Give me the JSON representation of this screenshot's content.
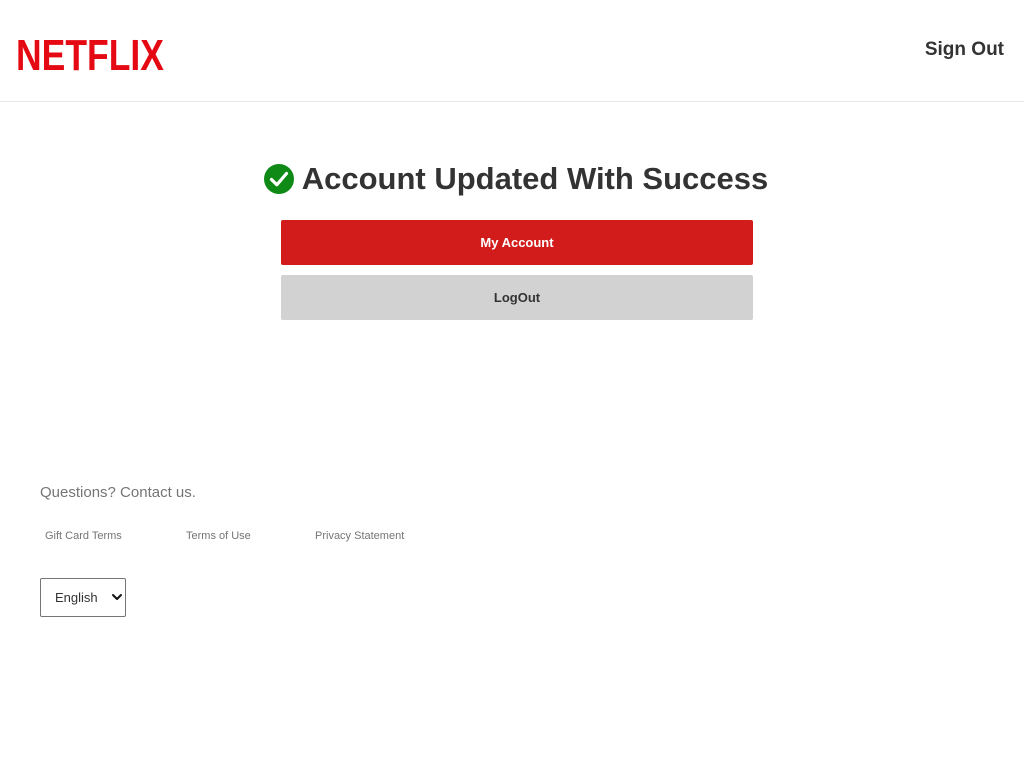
{
  "header": {
    "logo_text": "NETFLIX",
    "sign_out_label": "Sign Out"
  },
  "main": {
    "title": "Account Updated With Success",
    "status_icon": "check-circle-icon",
    "primary_button_label": "My Account",
    "secondary_button_label": "LogOut"
  },
  "footer": {
    "question": "Questions? Contact us.",
    "links": [
      {
        "label": "Gift Card Terms"
      },
      {
        "label": "Terms of Use"
      },
      {
        "label": "Privacy Statement"
      }
    ],
    "language": {
      "selected": "English",
      "icon": "chevron-down-icon"
    }
  },
  "colors": {
    "brand_red": "#e50914",
    "button_red": "#d21c1c",
    "button_gray": "#d2d2d2",
    "success_green": "#0f8a17",
    "text_dark": "#333333",
    "text_muted": "#757575"
  }
}
